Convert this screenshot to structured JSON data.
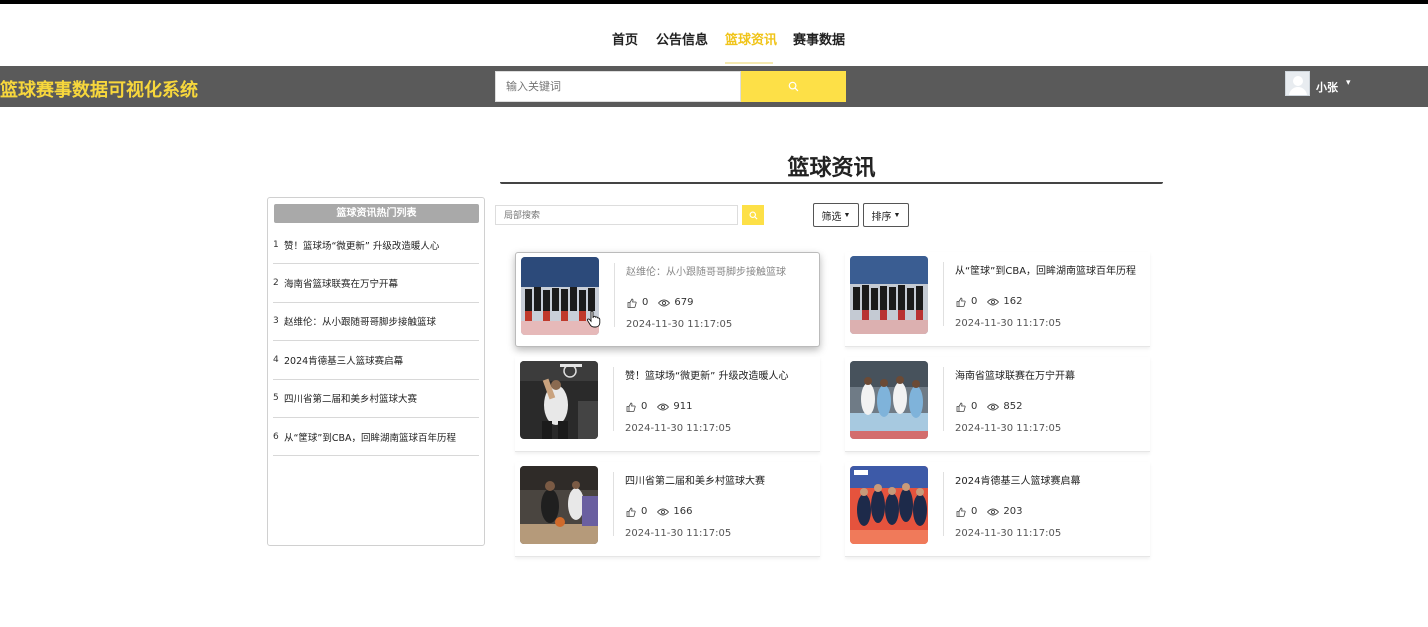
{
  "nav": {
    "items": [
      {
        "label": "首页",
        "active": false
      },
      {
        "label": "公告信息",
        "active": false
      },
      {
        "label": "篮球资讯",
        "active": true
      },
      {
        "label": "赛事数据",
        "active": false
      }
    ]
  },
  "header": {
    "site_title": "篮球赛事数据可视化系统",
    "search_placeholder": "输入关键词",
    "username": "小张"
  },
  "page": {
    "title": "篮球资讯"
  },
  "hot_list": {
    "title": "篮球资讯热门列表",
    "items": [
      {
        "num": "1",
        "text": "赞！篮球场“微更新” 升级改造暖人心"
      },
      {
        "num": "2",
        "text": "海南省篮球联赛在万宁开幕"
      },
      {
        "num": "3",
        "text": "赵维伦：从小跟随哥哥脚步接触篮球"
      },
      {
        "num": "4",
        "text": "2024肯德基三人篮球赛启幕"
      },
      {
        "num": "5",
        "text": "四川省第二届和美乡村篮球大赛"
      },
      {
        "num": "6",
        "text": "从“筐球”到CBA，回眸湖南篮球百年历程"
      }
    ]
  },
  "toolbar": {
    "local_search_placeholder": "局部搜索",
    "filter_label": "筛选",
    "sort_label": "排序"
  },
  "articles": [
    {
      "title": "赵维伦：从小跟随哥哥脚步接触篮球",
      "likes": "0",
      "views": "679",
      "date": "2024-11-30 11:17:05"
    },
    {
      "title": "从“筐球”到CBA，回眸湖南篮球百年历程",
      "likes": "0",
      "views": "162",
      "date": "2024-11-30 11:17:05"
    },
    {
      "title": "赞！篮球场“微更新” 升级改造暖人心",
      "likes": "0",
      "views": "911",
      "date": "2024-11-30 11:17:05"
    },
    {
      "title": "海南省篮球联赛在万宁开幕",
      "likes": "0",
      "views": "852",
      "date": "2024-11-30 11:17:05"
    },
    {
      "title": "四川省第二届和美乡村篮球大赛",
      "likes": "0",
      "views": "166",
      "date": "2024-11-30 11:17:05"
    },
    {
      "title": "2024肯德基三人篮球赛启幕",
      "likes": "0",
      "views": "203",
      "date": "2024-11-30 11:17:05"
    }
  ],
  "colors": {
    "accent": "#fde047",
    "title_yellow": "#f7d73c",
    "header_bg": "#5a5a5a"
  },
  "icons": {
    "search": "search-icon",
    "like": "thumbs-up-icon",
    "views": "eye-icon",
    "caret": "chevron-down-icon"
  }
}
